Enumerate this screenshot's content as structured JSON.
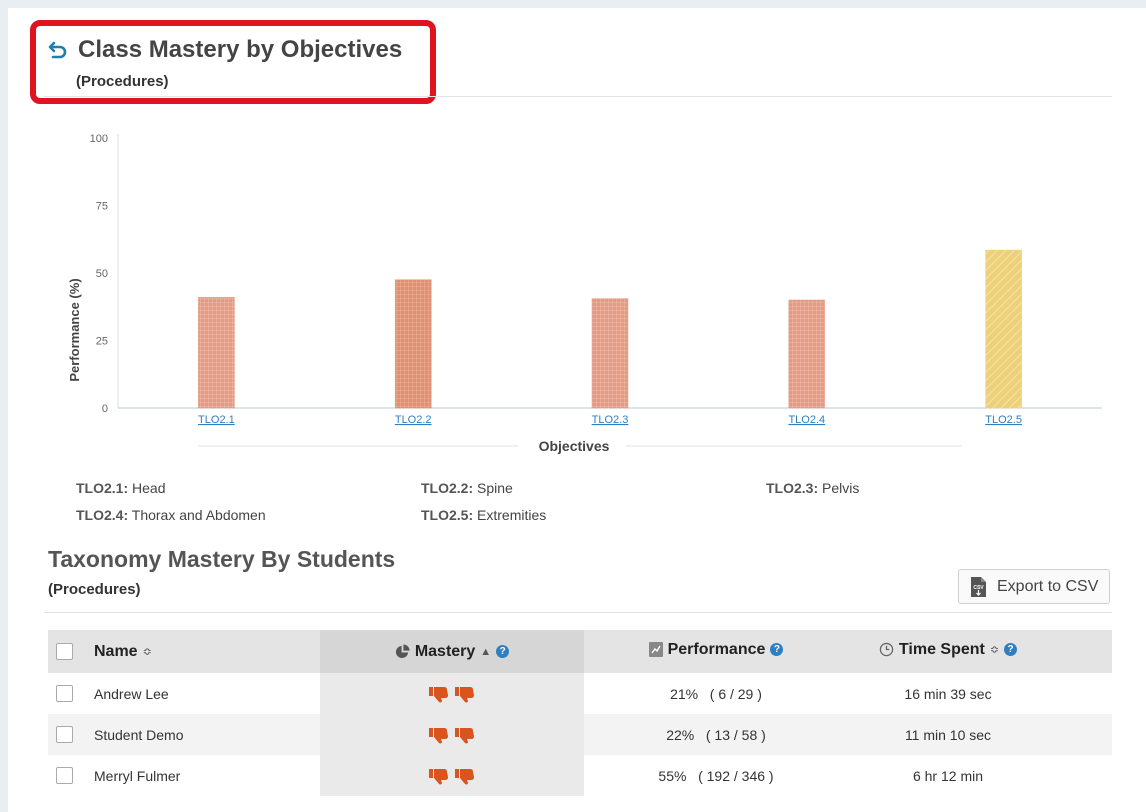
{
  "header": {
    "title": "Class Mastery by Objectives",
    "subtitle": "(Procedures)"
  },
  "chart_data": {
    "type": "bar",
    "categories": [
      "TLO2.1",
      "TLO2.2",
      "TLO2.3",
      "TLO2.4",
      "TLO2.5"
    ],
    "values": [
      41,
      47.5,
      40.5,
      40,
      58.5
    ],
    "colors": [
      "#e39a83",
      "#df9070",
      "#e39a83",
      "#e39a83",
      "#edd07a"
    ],
    "patterns": [
      "grid",
      "grid",
      "grid",
      "grid",
      "stripe"
    ],
    "xlabel": "Objectives",
    "ylabel": "Performance (%)",
    "ylim": [
      0,
      100
    ],
    "yticks": [
      0,
      25,
      50,
      75,
      100
    ]
  },
  "legend": [
    {
      "code": "TLO2.1:",
      "name": "Head"
    },
    {
      "code": "TLO2.2:",
      "name": "Spine"
    },
    {
      "code": "TLO2.3:",
      "name": "Pelvis"
    },
    {
      "code": "TLO2.4:",
      "name": "Thorax and Abdomen"
    },
    {
      "code": "TLO2.5:",
      "name": "Extremities"
    }
  ],
  "taxonomy": {
    "title": "Taxonomy Mastery By Students",
    "subtitle": "(Procedures)",
    "export_label": "Export to CSV"
  },
  "table": {
    "columns": {
      "name": "Name",
      "mastery": "Mastery",
      "performance": "Performance",
      "time": "Time Spent"
    },
    "rows": [
      {
        "name": "Andrew Lee",
        "performance": "21%   ( 6 / 29 )",
        "time": "16 min 39 sec"
      },
      {
        "name": "Student Demo",
        "performance": "22%   ( 13 / 58 )",
        "time": "11 min 10 sec"
      },
      {
        "name": "Merryl Fulmer",
        "performance": "55%   ( 192 / 346 )",
        "time": "6 hr 12 min"
      }
    ]
  },
  "icons": {
    "back": "back-arrow-icon",
    "mastery": "pie-chart-icon",
    "performance": "bar-chart-icon",
    "time": "clock-icon",
    "help": "help-icon",
    "export": "csv-file-icon",
    "thumbs": "thumbs-down-icon"
  },
  "colors": {
    "accent": "#1f7fa6",
    "highlight": "#e0141e",
    "thumbs": "#d9541e"
  }
}
